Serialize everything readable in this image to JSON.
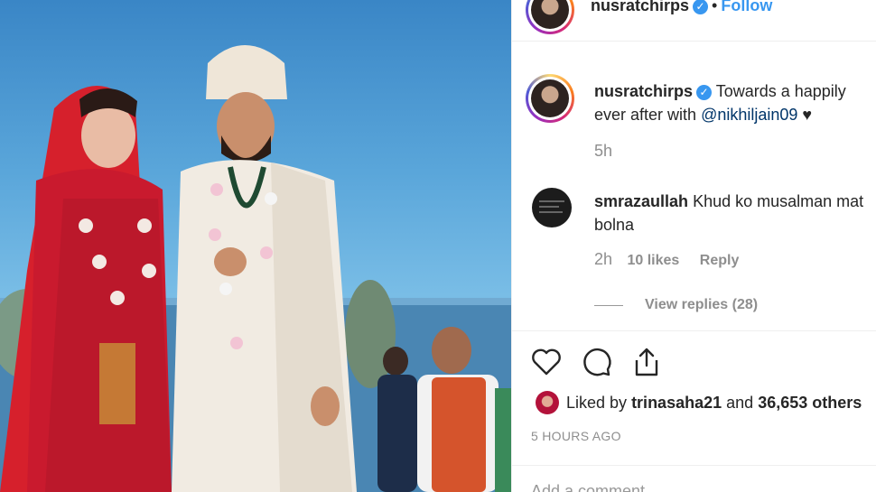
{
  "post": {
    "username": "nusratchirps",
    "follow_label": "Follow",
    "separator": "•",
    "caption_text": "Towards a happily ever after with",
    "caption_mention": "@nikhiljain09",
    "caption_emoji": "♥",
    "caption_time": "5h"
  },
  "comment": {
    "username": "smrazaullah",
    "text": "Khud ko musalman mat bolna",
    "time": "2h",
    "likes": "10 likes",
    "reply_label": "Reply",
    "view_replies": "View replies (28)"
  },
  "likes": {
    "prefix": "Liked by",
    "user": "trinasaha21",
    "conjunction": "and",
    "others": "36,653 others"
  },
  "timestamp": "5 HOURS AGO",
  "add_comment_placeholder": "Add a comment…",
  "icons": [
    "heart-icon",
    "comment-icon",
    "share-icon",
    "verified-badge-icon"
  ],
  "colors": {
    "accent": "#3897f0",
    "mention": "#003569",
    "muted": "#8e8e8e"
  }
}
